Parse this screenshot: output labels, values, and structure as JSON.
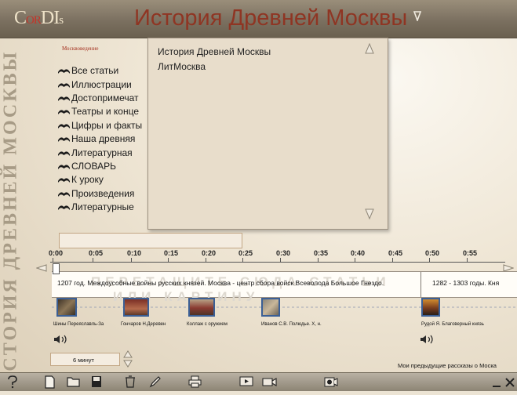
{
  "app": {
    "logo": {
      "part1": "C",
      "part2": "OR",
      "part3": "D",
      "part4": "I",
      "part5": "s"
    },
    "title": "История Древней Москвы"
  },
  "side_banner": "ИСТОРИЯ ДРЕВНЕЙ МОСКВЫ",
  "section_label": "Москвоведение",
  "menu": [
    "Все статьи",
    "Иллюстрации",
    "Достопримечат",
    "Театры и конце",
    "Цифры и факты",
    "Наша древняя",
    "Литературная",
    "СЛОВАРЬ",
    "К уроку",
    "Произведения",
    "Литературные"
  ],
  "dropdown": {
    "items": [
      "История Древней Москвы",
      "ЛитМосква"
    ]
  },
  "search": {
    "value": ""
  },
  "timeline": {
    "ticks": [
      "0:00",
      "0:05",
      "0:10",
      "0:15",
      "0:20",
      "0:25",
      "0:30",
      "0:35",
      "0:40",
      "0:45",
      "0:50",
      "0:55"
    ],
    "segments": [
      "1207 год. Междоусобные войны русских князей. Москва - центр сбора войск Всеволода Большое Гнездо.",
      "1282 - 1303 годы. Кня"
    ],
    "ghost_lines": [
      "ПЕРЕТАЩИТЕ СЮДА СТАТЬИ",
      "ИЛИ КАРТИНУ"
    ],
    "thumbnails": [
      {
        "label": "Шины Переяславль-За",
        "color": "#6e5a3e"
      },
      {
        "label": "Гончаров Н.Деревен",
        "color": "#9c4a3a"
      },
      {
        "label": "Коллаж с оружием",
        "color": "#8a3b31"
      },
      {
        "label": "Иванов С.В. Полюдье. Х, н.",
        "color": "#7a7468"
      },
      {
        "label": "Рудой Я. Благоверный князь",
        "color": "#c9832f"
      }
    ]
  },
  "duration": {
    "value": "6 минут"
  },
  "story_label": "Мои предыдущие рассказы о Моска",
  "toolbar": {
    "icons": [
      "help-icon",
      "new-document-icon",
      "open-folder-icon",
      "save-icon",
      "delete-icon",
      "edit-pencil-icon",
      "print-icon",
      "slideshow-icon",
      "camera-icon",
      "video-icon",
      "minimize-icon",
      "close-icon"
    ]
  },
  "colors": {
    "header": "#7b7060",
    "title": "#8f3523",
    "thumb_border": "#3b5f95"
  }
}
